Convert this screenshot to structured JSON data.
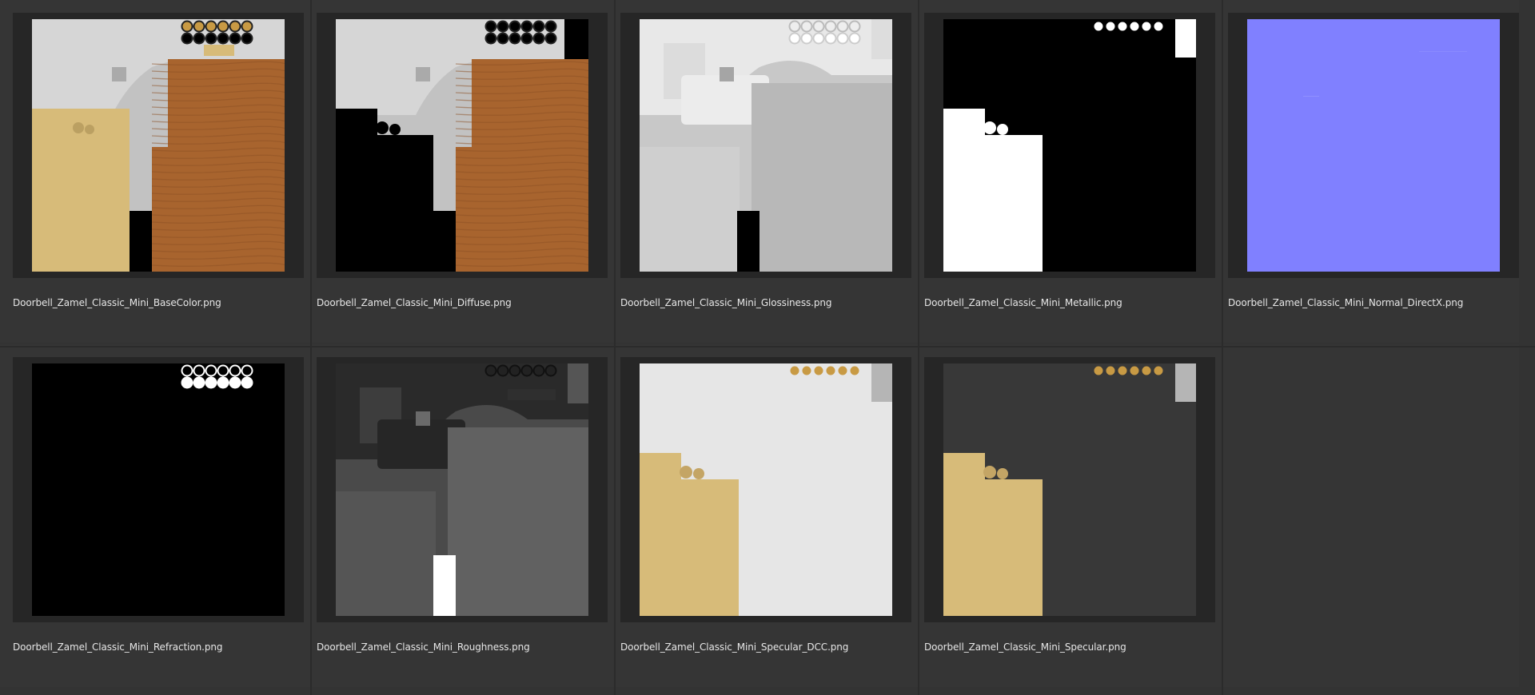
{
  "files": [
    {
      "name": "Doorbell_Zamel_Classic_Mini_BaseColor.png",
      "thumb": "basecolor"
    },
    {
      "name": "Doorbell_Zamel_Classic_Mini_Diffuse.png",
      "thumb": "diffuse"
    },
    {
      "name": "Doorbell_Zamel_Classic_Mini_Glossiness.png",
      "thumb": "glossiness"
    },
    {
      "name": "Doorbell_Zamel_Classic_Mini_Metallic.png",
      "thumb": "metallic"
    },
    {
      "name": "Doorbell_Zamel_Classic_Mini_Normal_DirectX.png",
      "thumb": "normal"
    },
    {
      "name": "Doorbell_Zamel_Classic_Mini_Refraction.png",
      "thumb": "refraction"
    },
    {
      "name": "Doorbell_Zamel_Classic_Mini_Roughness.png",
      "thumb": "roughness"
    },
    {
      "name": "Doorbell_Zamel_Classic_Mini_Specular_DCC.png",
      "thumb": "specular-dcc"
    },
    {
      "name": "Doorbell_Zamel_Classic_Mini_Specular.png",
      "thumb": "specular"
    }
  ],
  "colors": {
    "background": "#333333",
    "tile": "#353535",
    "thumb_frame": "#262626",
    "wood": "#a8642e",
    "wood_dark": "#8c5024",
    "gold": "#d7bb79",
    "gold_circle": "#c89a44",
    "light_gray": "#c9c9c9",
    "normal_blue": "#8080ff"
  }
}
